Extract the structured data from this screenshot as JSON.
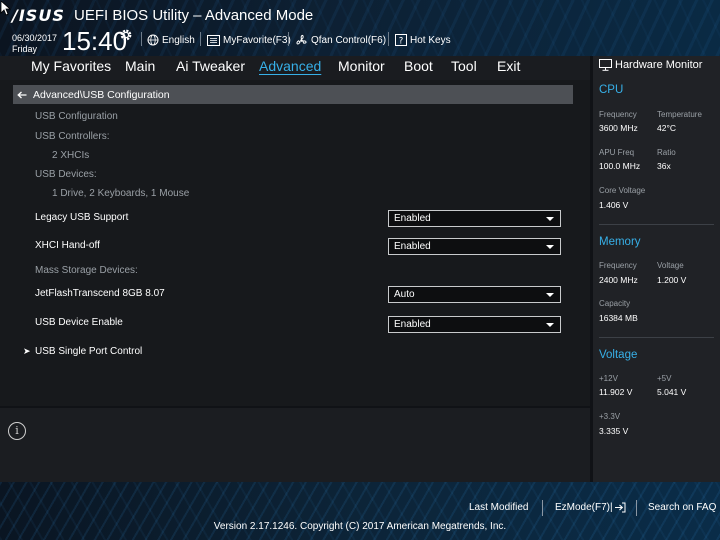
{
  "header": {
    "brand": "/ISUS",
    "title": "UEFI BIOS Utility – Advanced Mode",
    "date": "06/30/2017",
    "day": "Friday",
    "time": "15:40",
    "language": "English",
    "my_favorite": "MyFavorite(F3)",
    "qfan": "Qfan Control(F6)",
    "hot_keys": "Hot Keys"
  },
  "menu": {
    "items": [
      "My Favorites",
      "Main",
      "Ai Tweaker",
      "Advanced",
      "Monitor",
      "Boot",
      "Tool",
      "Exit"
    ],
    "active": "Advanced"
  },
  "main": {
    "breadcrumb": "Advanced\\USB Configuration",
    "usb_configuration": "USB Configuration",
    "usb_controllers_label": "USB Controllers:",
    "usb_controllers_value": "2 XHCIs",
    "usb_devices_label": "USB Devices:",
    "usb_devices_value": "1 Drive, 2 Keyboards, 1 Mouse",
    "legacy_usb_label": "Legacy USB Support",
    "legacy_usb_value": "Enabled",
    "xhci_label": "XHCI Hand-off",
    "xhci_value": "Enabled",
    "mass_storage_label": "Mass Storage Devices:",
    "jetflash_label": "JetFlashTranscend 8GB 8.07",
    "jetflash_value": "Auto",
    "usb_device_enable_label": "USB Device Enable",
    "usb_device_enable_value": "Enabled",
    "single_port_label": "USB Single Port Control"
  },
  "hw_monitor": {
    "title": "Hardware Monitor",
    "cpu": {
      "section": "CPU",
      "frequency_label": "Frequency",
      "frequency_value": "3600 MHz",
      "temperature_label": "Temperature",
      "temperature_value": "42°C",
      "apu_freq_label": "APU Freq",
      "apu_freq_value": "100.0 MHz",
      "ratio_label": "Ratio",
      "ratio_value": "36x",
      "core_voltage_label": "Core Voltage",
      "core_voltage_value": "1.406 V"
    },
    "memory": {
      "section": "Memory",
      "frequency_label": "Frequency",
      "frequency_value": "2400 MHz",
      "voltage_label": "Voltage",
      "voltage_value": "1.200 V",
      "capacity_label": "Capacity",
      "capacity_value": "16384 MB"
    },
    "voltage": {
      "section": "Voltage",
      "v12_label": "+12V",
      "v12_value": "11.902 V",
      "v5_label": "+5V",
      "v5_value": "5.041 V",
      "v33_label": "+3.3V",
      "v33_value": "3.335 V"
    }
  },
  "footer": {
    "last_modified": "Last Modified",
    "ezmode": "EzMode(F7)|",
    "search_faq": "Search on FAQ",
    "copyright": "Version 2.17.1246. Copyright (C) 2017 American Megatrends, Inc."
  },
  "colors": {
    "accent": "#37b0e8",
    "panel": "#17191c",
    "breadcrumb_bg": "#4d5055"
  }
}
